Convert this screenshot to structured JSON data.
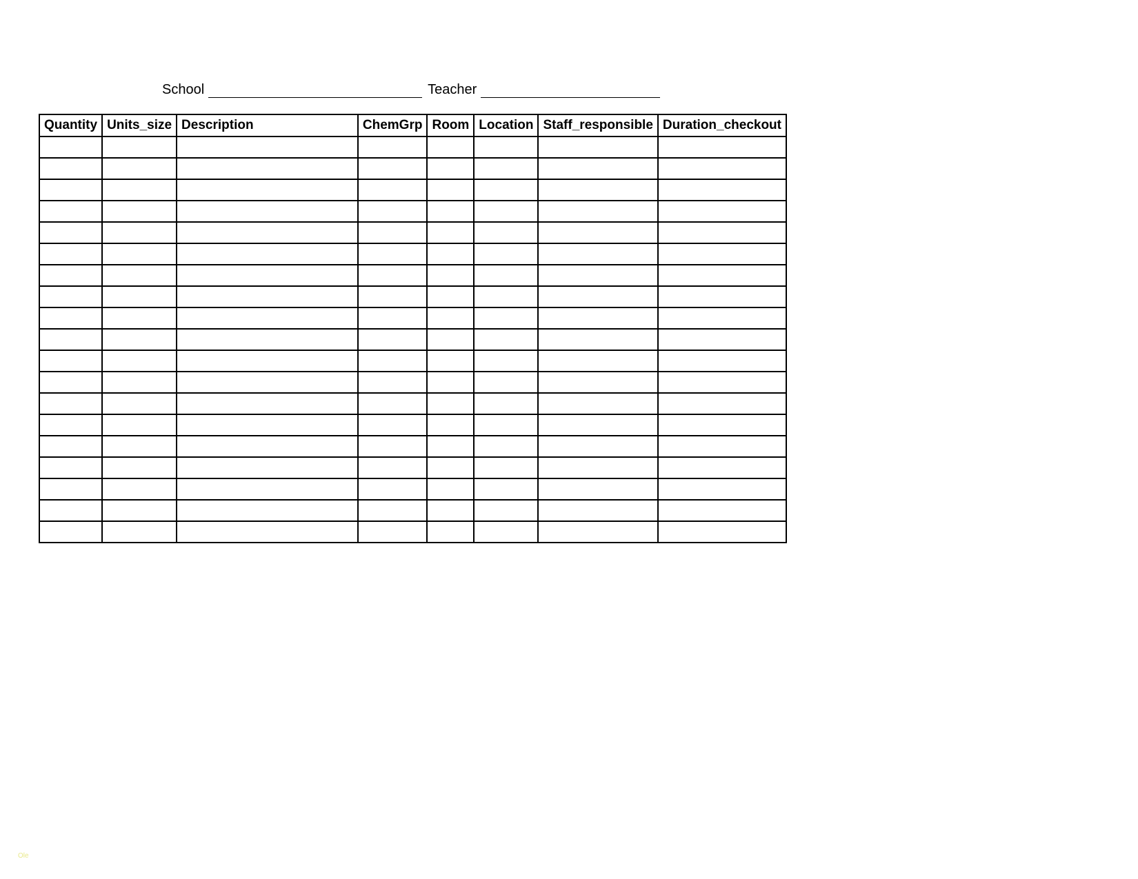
{
  "header": {
    "school_label": "School",
    "teacher_label": "Teacher"
  },
  "table": {
    "headers": {
      "quantity": "Quantity",
      "units_size": "Units_size",
      "description": "Description",
      "chemgrp": "ChemGrp",
      "room": "Room",
      "location": "Location",
      "staff_responsible": "Staff_responsible",
      "duration_checkout": "Duration_checkout"
    },
    "row_count": 19
  },
  "footer": {
    "mark": "Ole"
  }
}
